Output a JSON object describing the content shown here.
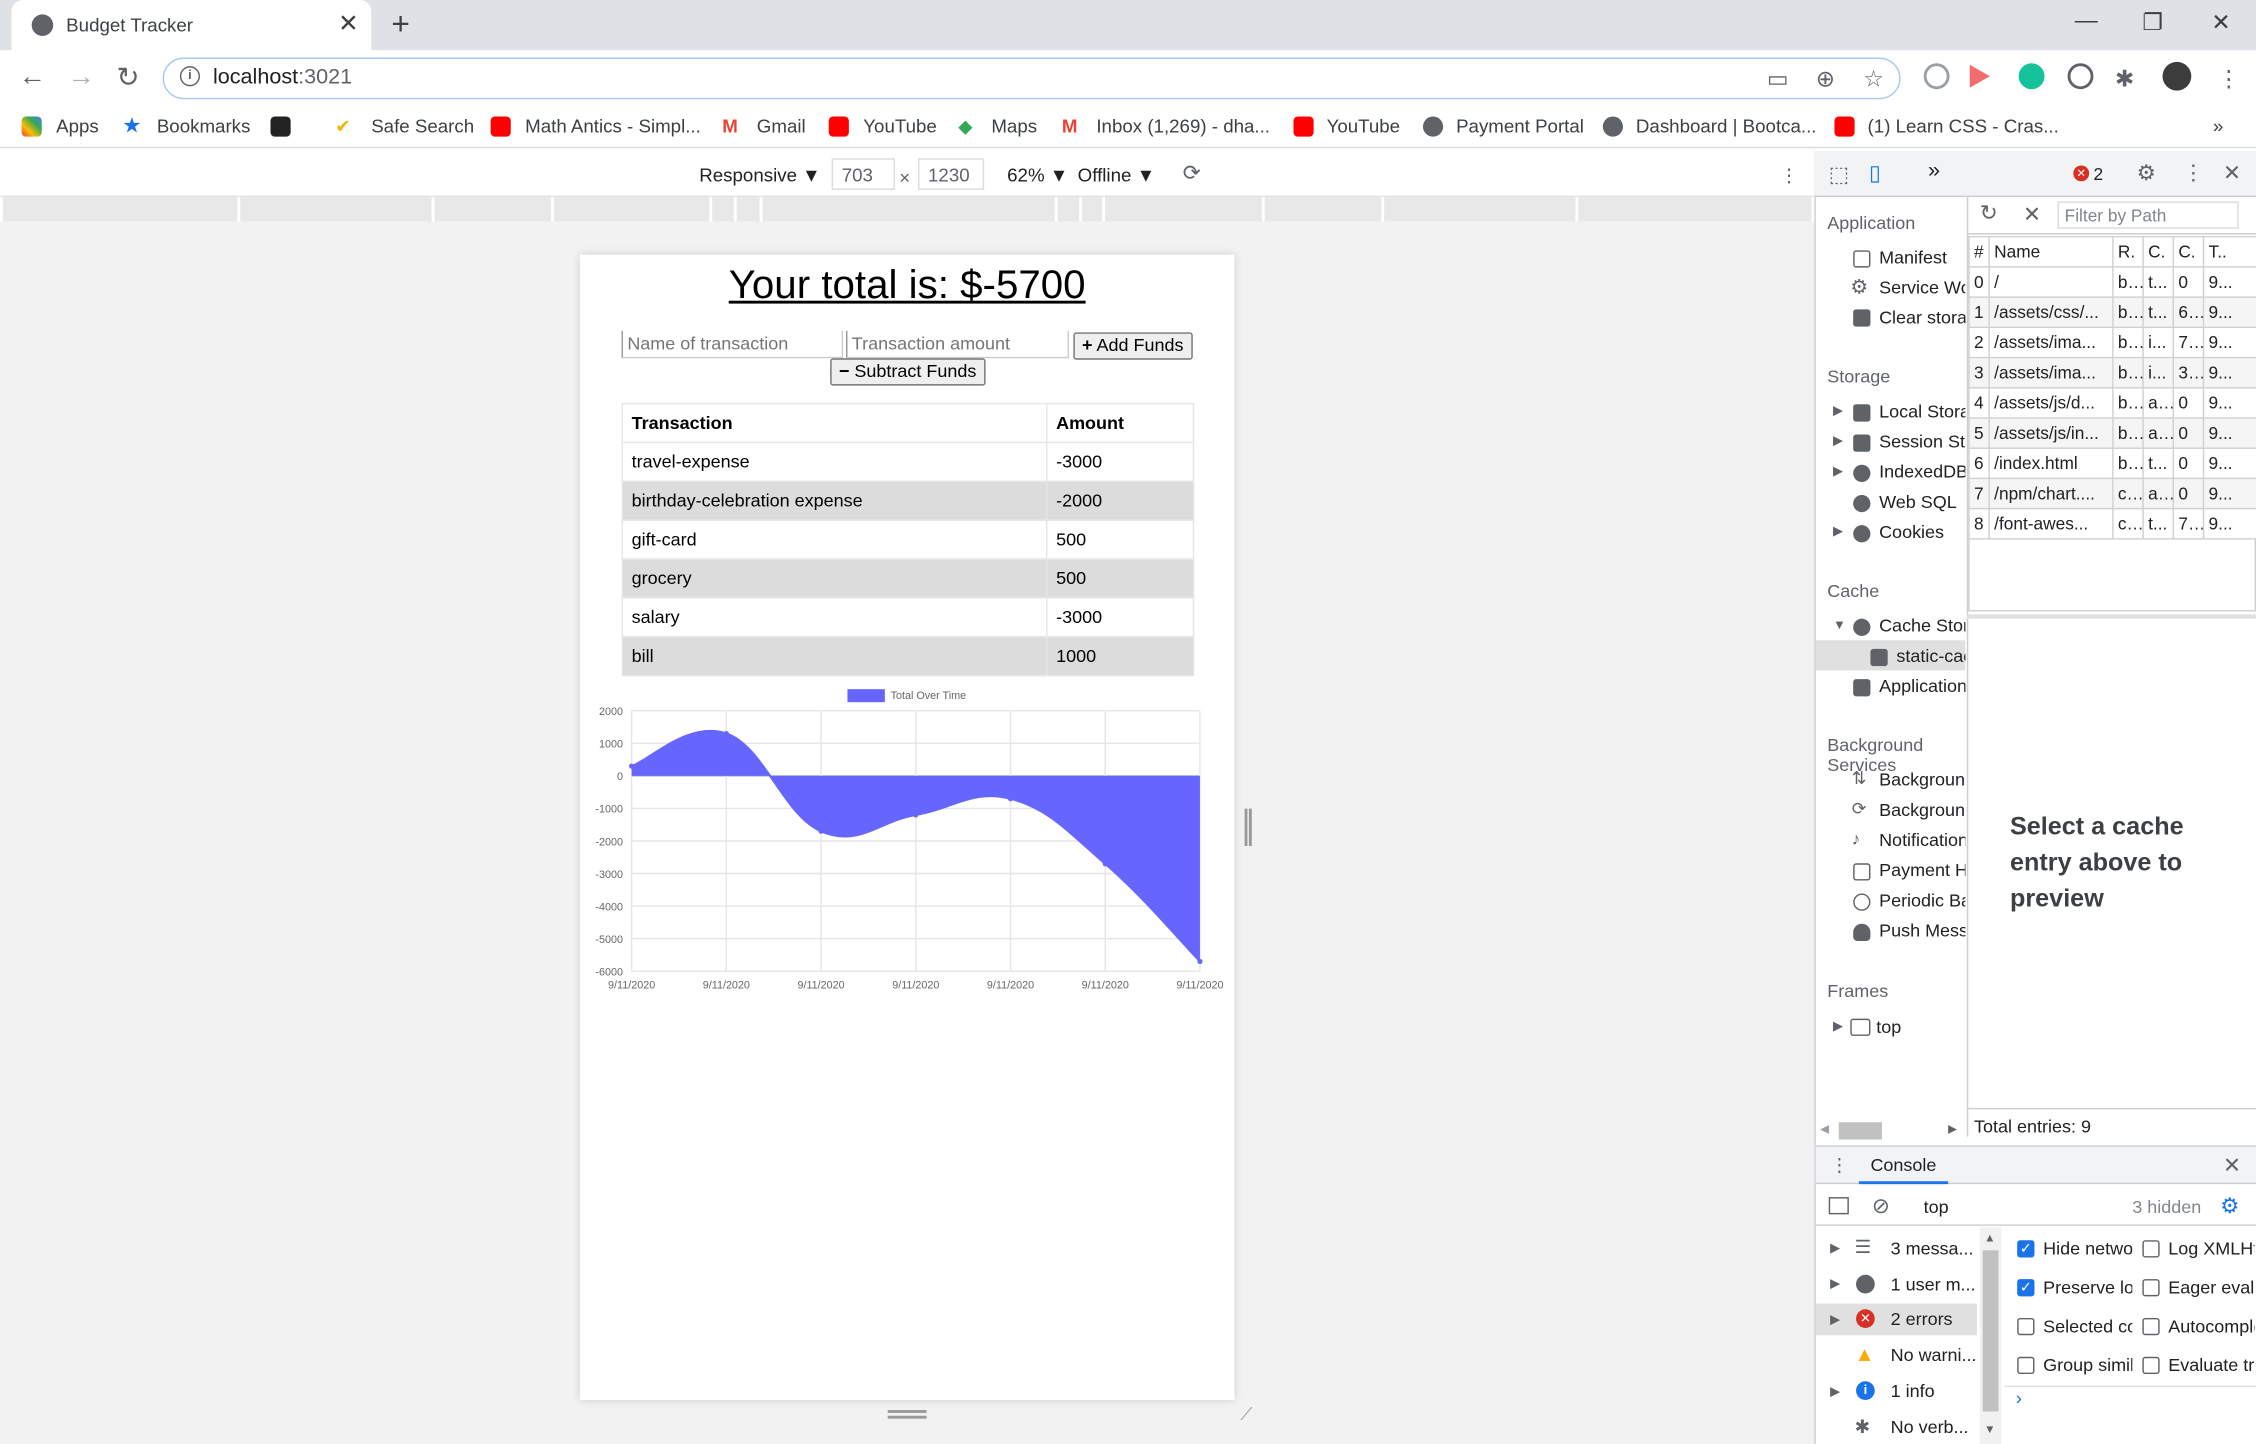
{
  "browser": {
    "tab_title": "Budget Tracker",
    "url_host": "localhost",
    "url_port": ":3021",
    "bookmarks": [
      "Apps",
      "Bookmarks",
      "Safe Search",
      "Math Antics - Simpl...",
      "Gmail",
      "YouTube",
      "Maps",
      "Inbox (1,269) - dha...",
      "YouTube",
      "Payment Portal",
      "Dashboard | Bootca...",
      "(1) Learn CSS - Cras..."
    ],
    "more": "»"
  },
  "device_toolbar": {
    "mode": "Responsive ▼",
    "width": "703",
    "times": "×",
    "height": "1230",
    "zoom": "62% ▼",
    "throttle": "Offline ▼"
  },
  "app": {
    "total": "Your total is: $-5700",
    "name_placeholder": "Name of transaction",
    "amount_placeholder": "Transaction amount",
    "add_label": "Add Funds",
    "subtract_label": "Subtract Funds",
    "col_transaction": "Transaction",
    "col_amount": "Amount",
    "rows": [
      {
        "name": "travel-expense",
        "amount": "-3000"
      },
      {
        "name": "birthday-celebration expense",
        "amount": "-2000"
      },
      {
        "name": "gift-card",
        "amount": "500"
      },
      {
        "name": "grocery",
        "amount": "500"
      },
      {
        "name": "salary",
        "amount": "-3000"
      },
      {
        "name": "bill",
        "amount": "1000"
      }
    ]
  },
  "chart_data": {
    "type": "area",
    "series": [
      {
        "name": "Total Over Time",
        "values": [
          300,
          1300,
          -1700,
          -1200,
          -700,
          -2700,
          -5700
        ]
      }
    ],
    "x": [
      "9/11/2020",
      "9/11/2020",
      "9/11/2020",
      "9/11/2020",
      "9/11/2020",
      "9/11/2020",
      "9/11/2020"
    ],
    "ylim": [
      -6000,
      2000
    ],
    "yticks": [
      "2000",
      "1000",
      "0",
      "-1000",
      "-2000",
      "-3000",
      "-4000",
      "-5000",
      "-6000"
    ],
    "color": "#6666ff",
    "grid": true,
    "legend": "top"
  },
  "devtools": {
    "error_count": "2",
    "application_header": "Application",
    "application_items": [
      "Manifest",
      "Service Workers",
      "Clear storage"
    ],
    "storage_header": "Storage",
    "storage_items": [
      "Local Storage",
      "Session Storage",
      "IndexedDB",
      "Web SQL",
      "Cookies"
    ],
    "cache_header": "Cache",
    "cache_items": [
      "Cache Storage",
      "static-cache",
      "Application Cache"
    ],
    "bg_header": "Background Services",
    "bg_items": [
      "Background Fetch",
      "Background Sync",
      "Notifications",
      "Payment Handler",
      "Periodic Background Sync",
      "Push Messaging"
    ],
    "frames_header": "Frames",
    "frames_items": [
      "top"
    ],
    "filter_placeholder": "Filter by Path",
    "cache_columns": [
      "#",
      "Name",
      "R.",
      "C.",
      "C.",
      "T.."
    ],
    "cache_rows": [
      [
        "0",
        "/",
        "b...",
        "t...",
        "0",
        "9..."
      ],
      [
        "1",
        "/assets/css/...",
        "b...",
        "t...",
        "6...",
        "9..."
      ],
      [
        "2",
        "/assets/ima...",
        "b...",
        "i...",
        "7...",
        "9..."
      ],
      [
        "3",
        "/assets/ima...",
        "b...",
        "i...",
        "3...",
        "9..."
      ],
      [
        "4",
        "/assets/js/d...",
        "b...",
        "a...",
        "0",
        "9..."
      ],
      [
        "5",
        "/assets/js/in...",
        "b...",
        "a...",
        "0",
        "9..."
      ],
      [
        "6",
        "/index.html",
        "b...",
        "t...",
        "0",
        "9..."
      ],
      [
        "7",
        "/npm/chart....",
        "c...",
        "a...",
        "0",
        "9..."
      ],
      [
        "8",
        "/font-awes...",
        "c...",
        "t...",
        "7...",
        "9..."
      ]
    ],
    "preview_text": "Select a cache entry above to preview",
    "total_entries": "Total entries: 9",
    "console_tab": "Console",
    "context": "top",
    "hidden": "3 hidden",
    "console_items": [
      "3 messa...",
      "1 user m...",
      "2 errors",
      "No warni...",
      "1 info",
      "No verb..."
    ],
    "settings": [
      {
        "label": "Hide network",
        "on": true
      },
      {
        "label": "Log XMLHttpRequests",
        "on": false
      },
      {
        "label": "Preserve log",
        "on": true
      },
      {
        "label": "Eager evaluation",
        "on": false
      },
      {
        "label": "Selected context only",
        "on": false
      },
      {
        "label": "Autocomplete from history",
        "on": false
      },
      {
        "label": "Group similar",
        "on": false
      },
      {
        "label": "Evaluate triggers user activation",
        "on": false
      }
    ]
  }
}
